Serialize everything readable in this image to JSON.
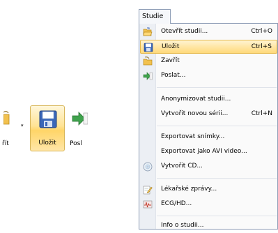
{
  "ribbon": {
    "partial_left_label": "řít",
    "save_label": "Uložit",
    "next_label": "Posl"
  },
  "menu": {
    "title": "Studie",
    "items": [
      {
        "label": "Otevřít studii...",
        "shortcut": "Ctrl+O",
        "icon": "folder-open-icon"
      },
      {
        "label": "Uložit",
        "shortcut": "Ctrl+S",
        "icon": "floppy-disk-icon",
        "highlighted": true
      },
      {
        "label": "Zavřít",
        "shortcut": "",
        "icon": "folder-close-icon"
      },
      {
        "label": "Poslat...",
        "shortcut": "",
        "icon": "send-icon"
      },
      {
        "label": "Anonymizovat studii...",
        "shortcut": ""
      },
      {
        "label": "Vytvořit novou sérii...",
        "shortcut": "Ctrl+N"
      },
      {
        "label": "Exportovat snímky...",
        "shortcut": ""
      },
      {
        "label": "Exportovat jako AVI video...",
        "shortcut": ""
      },
      {
        "label": "Vytvořit CD...",
        "shortcut": "",
        "icon": "cd-icon"
      },
      {
        "label": "Lékařské zprávy...",
        "shortcut": "",
        "icon": "report-icon"
      },
      {
        "label": "ECG/HD...",
        "shortcut": "",
        "icon": "ecg-icon"
      },
      {
        "label": "Info o studii...",
        "shortcut": ""
      }
    ]
  }
}
